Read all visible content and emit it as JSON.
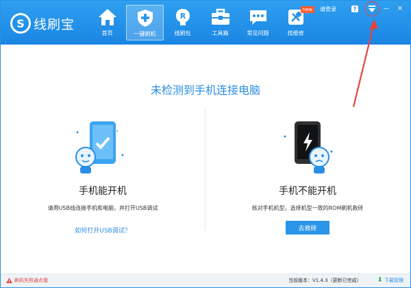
{
  "app": {
    "name": "线刷宝",
    "logo_letter": "S"
  },
  "nav": [
    {
      "label": "首页",
      "icon": "home-icon"
    },
    {
      "label": "一键刷机",
      "icon": "shield-plus-icon",
      "active": true
    },
    {
      "label": "线刷包",
      "icon": "rom-package-icon",
      "icon_letter": "R"
    },
    {
      "label": "工具箱",
      "icon": "toolbox-icon"
    },
    {
      "label": "常见问题",
      "icon": "chat-icon"
    },
    {
      "label": "找维修",
      "icon": "repair-tools-icon",
      "badge": "new"
    }
  ],
  "topbar": {
    "login": "请登录",
    "help": "?",
    "menu_icon": "menu-dropdown-icon",
    "minimize": "—",
    "close": "✕"
  },
  "main": {
    "title": "未检测到手机连接电脑",
    "left": {
      "title": "手机能开机",
      "desc": "请用USB线连接手机和电脑，并打开USB调试",
      "link": "如何打开USB调试？"
    },
    "right": {
      "title": "手机不能开机",
      "desc": "核对手机机型，选择机型一致的ROM刷机救砖",
      "button": "去救砖"
    }
  },
  "statusbar": {
    "report": "刷机失败通点我",
    "version": "当前版本：V1.4.3（更新已完成）",
    "download": "下载管理"
  },
  "colors": {
    "brand": "#1a86e3",
    "accent": "#2a8ee3",
    "annotation": "#e8413b",
    "badge": "#ff5a2d"
  }
}
